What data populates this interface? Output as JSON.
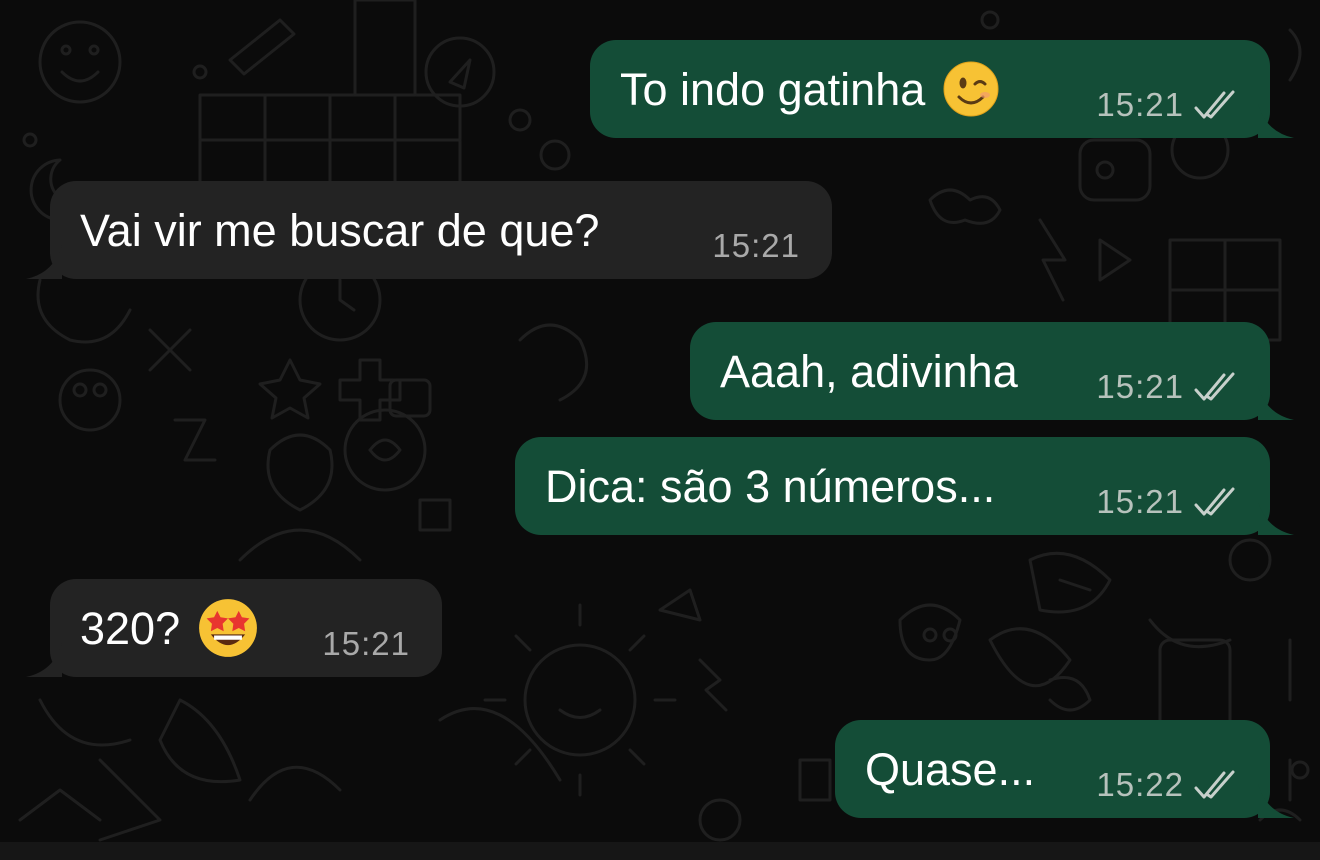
{
  "colors": {
    "background": "#0b0b0b",
    "outgoing_bubble": "#144d37",
    "incoming_bubble": "#232323",
    "text": "#ffffff",
    "timestamp": "#b7c2bc"
  },
  "messages": [
    {
      "direction": "outgoing",
      "text": "To indo gatinha",
      "emoji": "winking-face",
      "time": "15:21",
      "status": "read"
    },
    {
      "direction": "incoming",
      "text": "Vai vir me buscar de que?",
      "time": "15:21"
    },
    {
      "direction": "outgoing",
      "text": "Aaah, adivinha",
      "time": "15:21",
      "status": "read"
    },
    {
      "direction": "outgoing",
      "text": "Dica: são 3 números...",
      "time": "15:21",
      "status": "read"
    },
    {
      "direction": "incoming",
      "text": "320?",
      "emoji": "star-struck",
      "time": "15:21"
    },
    {
      "direction": "outgoing",
      "text": "Quase...",
      "time": "15:22",
      "status": "read"
    }
  ]
}
